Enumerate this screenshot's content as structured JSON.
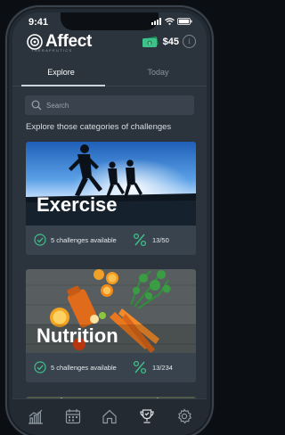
{
  "status": {
    "time": "9:41"
  },
  "app": {
    "name": "Affect",
    "subtitle": "THERAPEUTICS"
  },
  "balance": {
    "value": "$45",
    "info_label": "i"
  },
  "tabs": [
    {
      "label": "Explore",
      "active": true
    },
    {
      "label": "Today",
      "active": false
    }
  ],
  "search": {
    "placeholder": "Search",
    "value": ""
  },
  "section_title": "Explore those categories of challenges",
  "categories": [
    {
      "label": "Exercise",
      "available": "5 challenges available",
      "progress": "13/50"
    },
    {
      "label": "Nutrition",
      "available": "5 challenges available",
      "progress": "13/234"
    }
  ],
  "nav": [
    "chart-icon",
    "calendar-icon",
    "home-icon",
    "trophy-icon",
    "settings-icon"
  ],
  "colors": {
    "accent_green": "#3fc18b",
    "background": "#2b333c",
    "card_footer": "#39434d"
  }
}
